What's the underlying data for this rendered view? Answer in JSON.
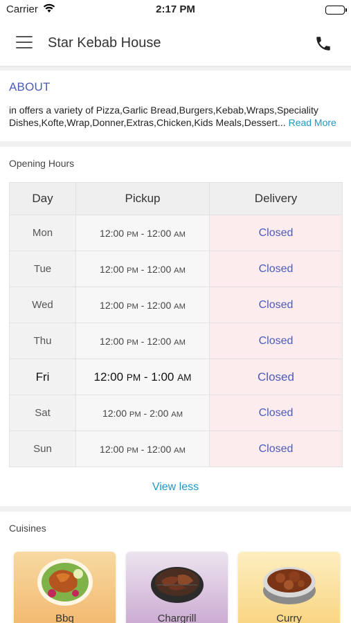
{
  "status_bar": {
    "carrier": "Carrier",
    "time": "2:17 PM"
  },
  "header": {
    "title": "Star Kebab House",
    "menu_icon": "hamburger-icon",
    "call_icon": "phone-icon"
  },
  "about": {
    "title": "ABOUT",
    "text": "in  offers a variety of Pizza,Garlic Bread,Burgers,Kebab,Wraps,Speciality Dishes,Kofte,Wrap,Donner,Extras,Chicken,Kids Meals,Dessert...",
    "read_more": "Read More"
  },
  "opening_hours": {
    "label": "Opening Hours",
    "columns": [
      "Day",
      "Pickup",
      "Delivery"
    ],
    "rows": [
      {
        "day": "Mon",
        "pickup_open": "12:00",
        "pickup_open_period": "PM",
        "pickup_close": "12:00",
        "pickup_close_period": "AM",
        "delivery": "Closed"
      },
      {
        "day": "Tue",
        "pickup_open": "12:00",
        "pickup_open_period": "PM",
        "pickup_close": "12:00",
        "pickup_close_period": "AM",
        "delivery": "Closed"
      },
      {
        "day": "Wed",
        "pickup_open": "12:00",
        "pickup_open_period": "PM",
        "pickup_close": "12:00",
        "pickup_close_period": "AM",
        "delivery": "Closed"
      },
      {
        "day": "Thu",
        "pickup_open": "12:00",
        "pickup_open_period": "PM",
        "pickup_close": "12:00",
        "pickup_close_period": "AM",
        "delivery": "Closed"
      },
      {
        "day": "Fri",
        "pickup_open": "12:00",
        "pickup_open_period": "PM",
        "pickup_close": "1:00",
        "pickup_close_period": "AM",
        "delivery": "Closed",
        "today": true
      },
      {
        "day": "Sat",
        "pickup_open": "12:00",
        "pickup_open_period": "PM",
        "pickup_close": "2:00",
        "pickup_close_period": "AM",
        "delivery": "Closed"
      },
      {
        "day": "Sun",
        "pickup_open": "12:00",
        "pickup_open_period": "PM",
        "pickup_close": "12:00",
        "pickup_close_period": "AM",
        "delivery": "Closed"
      }
    ],
    "toggle_label": "View less"
  },
  "cuisines": {
    "label": "Cuisines",
    "items": [
      {
        "name": "Bbq",
        "icon": "bbq-chicken-icon"
      },
      {
        "name": "Chargrill",
        "icon": "chargrill-icon"
      },
      {
        "name": "Curry",
        "icon": "curry-icon"
      }
    ]
  },
  "colors": {
    "accent": "#4a5bbd",
    "link": "#2196c4",
    "closed_bg": "#fcecee"
  }
}
